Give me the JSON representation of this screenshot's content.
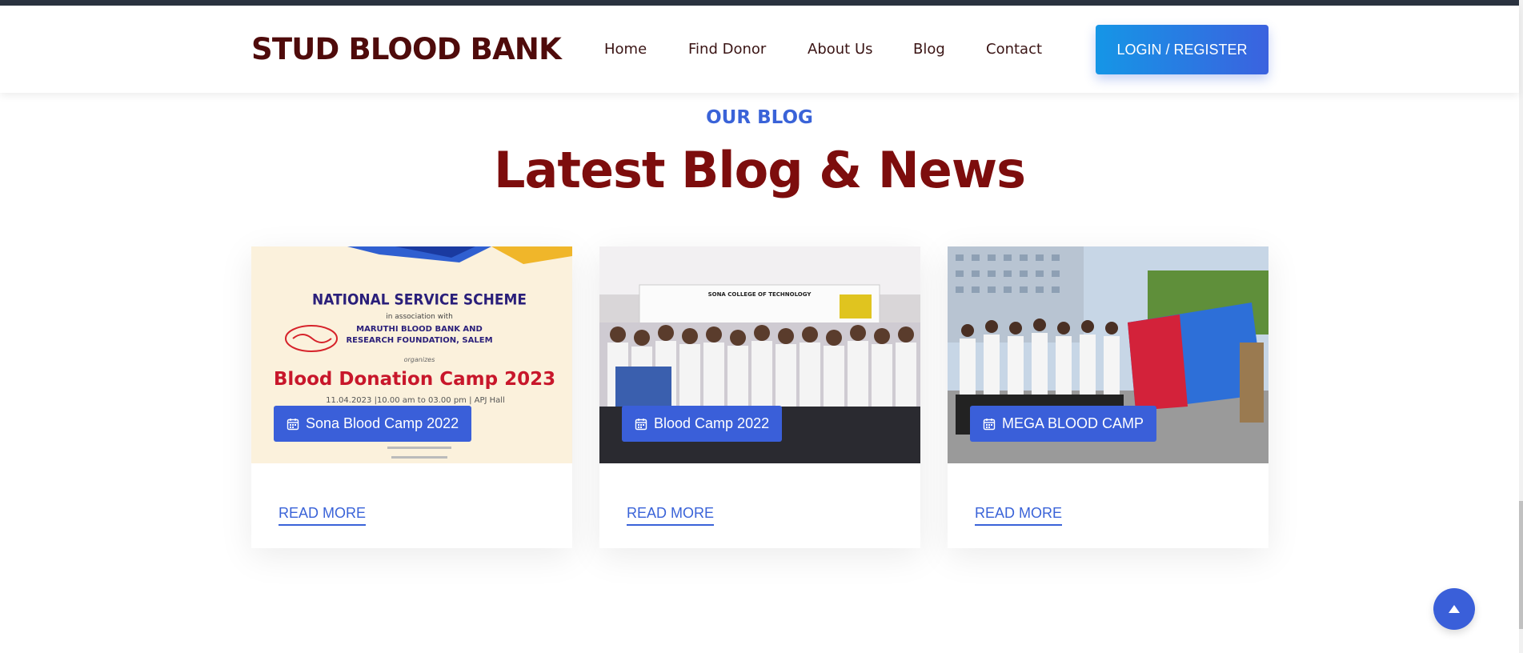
{
  "header": {
    "logo": "STUD BLOOD BANK",
    "nav": [
      {
        "label": "Home"
      },
      {
        "label": "Find Donor"
      },
      {
        "label": "About Us"
      },
      {
        "label": "Blog"
      },
      {
        "label": "Contact"
      }
    ],
    "login_label": "LOGIN / REGISTER"
  },
  "section": {
    "kicker": "OUR BLOG",
    "title": "Latest Blog & News"
  },
  "cards": [
    {
      "badge": "Sona Blood Camp 2022",
      "read_more": "READ MORE",
      "poster": {
        "line1": "NATIONAL SERVICE SCHEME",
        "line2": "in association with",
        "line3": "MARUTHI BLOOD BANK AND",
        "line4": "RESEARCH FOUNDATION, SALEM",
        "line5": "organizes",
        "line6": "Blood Donation Camp 2023",
        "line7": "11.04.2023 |10.00 am to 03.00 pm | APJ Hall"
      }
    },
    {
      "badge": "Blood Camp 2022",
      "read_more": "READ MORE",
      "banner": "SONA COLLEGE OF TECHNOLOGY"
    },
    {
      "badge": "MEGA BLOOD CAMP",
      "read_more": "READ MORE"
    }
  ],
  "colors": {
    "brand_dark": "#4f0b0b",
    "title_red": "#7d0d0d",
    "accent_blue": "#3a5fd9"
  }
}
